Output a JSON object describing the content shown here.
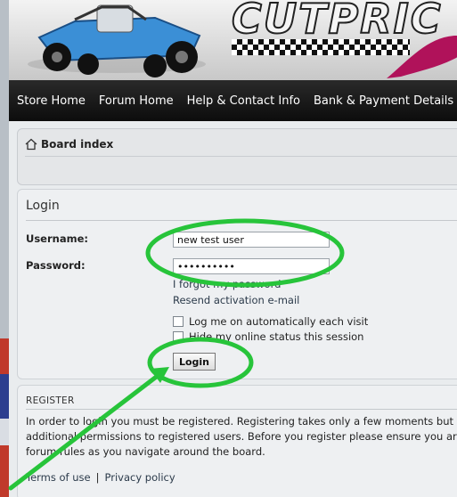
{
  "nav": {
    "items": [
      "Store Home",
      "Forum Home",
      "Help & Contact Info",
      "Bank & Payment Details"
    ]
  },
  "breadcrumb": {
    "label": "Board index",
    "icon": "home-icon"
  },
  "login": {
    "title": "Login",
    "username_label": "Username:",
    "username_value": "new test user",
    "password_label": "Password:",
    "password_value": "••••••••••",
    "forgot_link": "I forgot my password",
    "resend_link": "Resend activation e-mail",
    "remember_label": "Log me on automatically each visit",
    "hide_label": "Hide my online status this session",
    "button_label": "Login"
  },
  "register": {
    "title": "REGISTER",
    "text_line1": "In order to login you must be registered. Registering takes only a few moments but give",
    "text_line2": "additional permissions to registered users. Before you register please ensure you are fa",
    "text_line3": "forum rules as you navigate around the board.",
    "terms_link": "Terms of use",
    "separator": "|",
    "privacy_link": "Privacy policy"
  },
  "colors": {
    "nav_bg": "#0c0c0c",
    "annotation": "#27c43a",
    "panel_bg": "#eef0f2"
  }
}
